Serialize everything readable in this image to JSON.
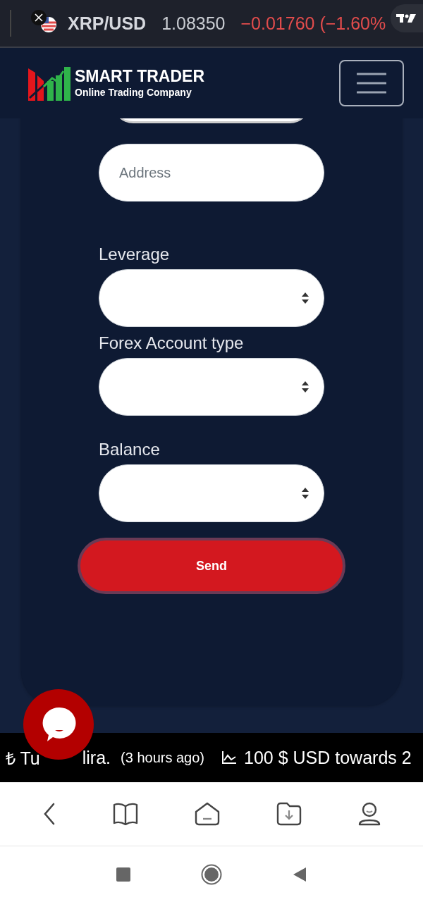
{
  "ticker": {
    "symbol": "XRP/USD",
    "price": "1.08350",
    "change": "−0.01760 (−1.60%"
  },
  "header": {
    "brand": "SMART TRADER",
    "tagline": "Online Trading Company"
  },
  "form": {
    "address": {
      "placeholder": "Address"
    },
    "selects": [
      {
        "label": "Leverage"
      },
      {
        "label": "Forex Account type"
      },
      {
        "label": "Balance"
      }
    ],
    "send": "Send"
  },
  "news": [
    {
      "symbol": "₺",
      "text_start": "Tu",
      "text_end": "lira.",
      "time": "(3 hours ago)"
    },
    {
      "text": "100 $ USD towards 2"
    }
  ]
}
